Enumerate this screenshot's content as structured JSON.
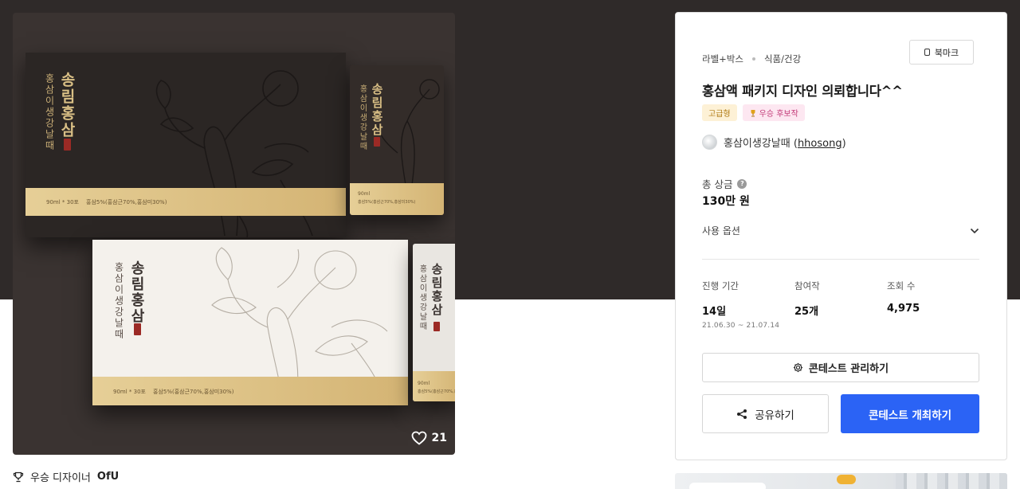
{
  "hero": {
    "likes": "21",
    "packaging": {
      "brand_text": "송림홍삼",
      "sub_text": "홍삼이생강날때",
      "band_volume": "90ml * 30포",
      "band_ingredients": "홍삼5%(홍삼근70%,홍삼미30%)",
      "pouch_band_volume": "90ml",
      "pouch_band_ingredients": "홍삼5%(홍삼근70%,홍삼미30%)"
    }
  },
  "winner_caption": {
    "prefix": "우승 디자이너",
    "designer": "OfU"
  },
  "panel": {
    "category_primary": "라벨+박스",
    "category_secondary": "식품/건강",
    "bookmark_label": "북마크",
    "title": "홍삼액 패키지 디자인 의뢰합니다^^",
    "badges": {
      "tier": "고급형",
      "status": "우승 후보작"
    },
    "host": {
      "name": "홍삼이생강날때 (",
      "handle": "hhosong",
      "close": ")"
    },
    "prize": {
      "label": "총 상금",
      "value": "130만 원"
    },
    "options_label": "사용 옵션",
    "stats": {
      "period_label": "진행 기간",
      "period_value": "14일",
      "period_range": "21.06.30  ~  21.07.14",
      "entries_label": "참여작",
      "entries_value": "25개",
      "views_label": "조회 수",
      "views_value": "4,975"
    },
    "manage_button": "콘테스트 관리하기",
    "share_button": "공유하기",
    "host_button": "콘테스트 개최하기"
  },
  "colors": {
    "primary_button": "#2b63f5",
    "dark_backdrop": "#2f2a29",
    "gold_band": "#d4b474"
  }
}
